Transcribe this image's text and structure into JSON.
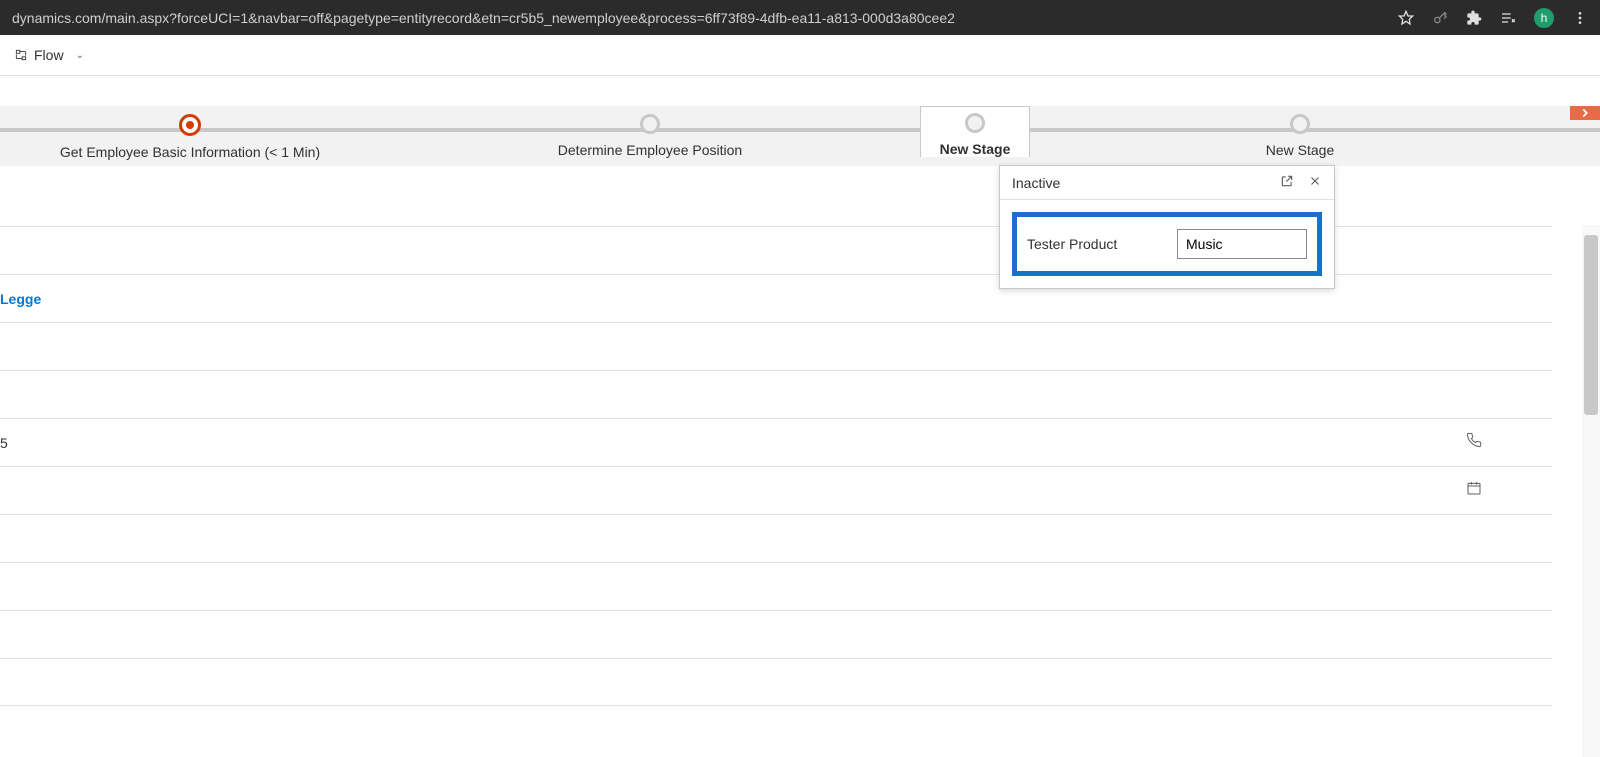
{
  "browser": {
    "url": "dynamics.com/main.aspx?forceUCI=1&navbar=off&pagetype=entityrecord&etn=cr5b5_newemployee&process=6ff73f89-4dfb-ea11-a813-000d3a80cee2",
    "avatar_letter": "h"
  },
  "toolbar": {
    "flow_label": "Flow"
  },
  "process": {
    "stages": [
      {
        "label": "Get Employee Basic Information  (< 1 Min)"
      },
      {
        "label": "Determine Employee Position"
      },
      {
        "label": "New Stage"
      },
      {
        "label": "New Stage"
      }
    ]
  },
  "flyout": {
    "status": "Inactive",
    "field_label": "Tester Product",
    "field_value": "Music"
  },
  "form": {
    "link_value": "Legge",
    "phone_value": "5"
  }
}
